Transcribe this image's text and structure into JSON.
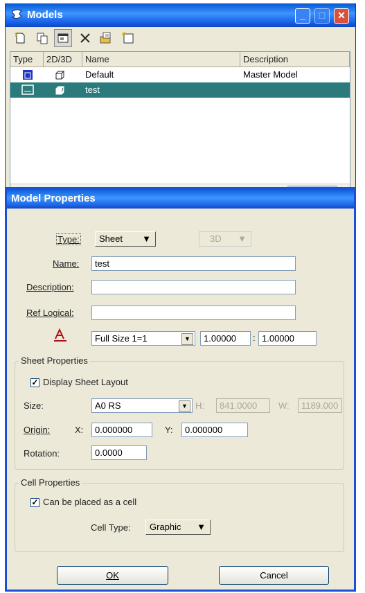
{
  "models_window": {
    "title": "Models",
    "toolbar": [
      "new-model-icon",
      "copy-model-icon",
      "properties-icon",
      "delete-icon",
      "import-icon",
      "new-dialog-icon"
    ],
    "columns": [
      "Type",
      "2D/3D",
      "Name",
      "Description"
    ],
    "rows": [
      {
        "name": "Default",
        "description": "Master Model",
        "selected": false
      },
      {
        "name": "test",
        "description": "",
        "selected": true
      }
    ]
  },
  "props": {
    "title": "Model Properties",
    "type_label": "Type:",
    "type_value": "Sheet",
    "dim_value": "3D",
    "name_label": "Name:",
    "name_value": "test",
    "description_label": "Description:",
    "description_value": "",
    "ref_logical_label": "Ref Logical:",
    "ref_logical_value": "",
    "annotation_scale": "Full Size 1=1",
    "scale_left": "1.00000",
    "scale_sep": ":",
    "scale_right": "1.00000",
    "sheet_group": "Sheet Properties",
    "display_sheet_layout": "Display Sheet Layout",
    "size_label": "Size:",
    "size_value": "A0 RS",
    "h_label": "H:",
    "h_value": "841.0000",
    "w_label": "W:",
    "w_value": "1189.000",
    "origin_label": "Origin:",
    "x_label": "X:",
    "x_value": "0.000000",
    "y_label": "Y:",
    "y_value": "0.000000",
    "rotation_label": "Rotation:",
    "rotation_value": "0.0000",
    "cell_group": "Cell Properties",
    "can_be_placed": "Can be placed as a cell",
    "cell_type_label": "Cell Type:",
    "cell_type_value": "Graphic",
    "ok": "OK",
    "cancel": "Cancel",
    "checkmark": "✓"
  }
}
